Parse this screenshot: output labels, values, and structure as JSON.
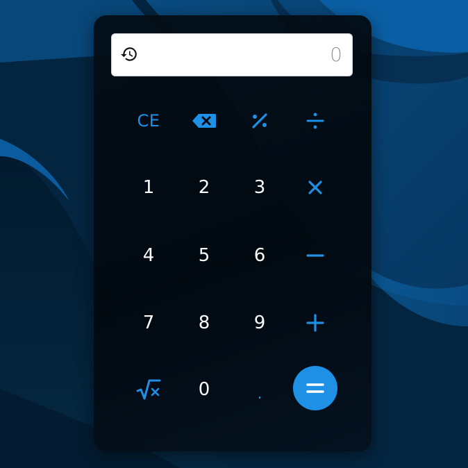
{
  "colors": {
    "accent": "#1e90e6",
    "digit": "#ffffff",
    "display_bg": "#ffffff",
    "display_text": "#9a9a9a",
    "panel_bg": "#030b13"
  },
  "display": {
    "value": "0",
    "history_icon": "history-icon"
  },
  "keys": {
    "ce": "CE",
    "backspace_icon": "backspace-icon",
    "percent_icon": "percent-icon",
    "divide_icon": "divide-icon",
    "d1": "1",
    "d2": "2",
    "d3": "3",
    "multiply_icon": "multiply-icon",
    "d4": "4",
    "d5": "5",
    "d6": "6",
    "minus_icon": "minus-icon",
    "d7": "7",
    "d8": "8",
    "d9": "9",
    "plus_icon": "plus-icon",
    "sqrt_icon": "square-root-icon",
    "d0": "0",
    "dot": ".",
    "equals_icon": "equals-icon"
  }
}
